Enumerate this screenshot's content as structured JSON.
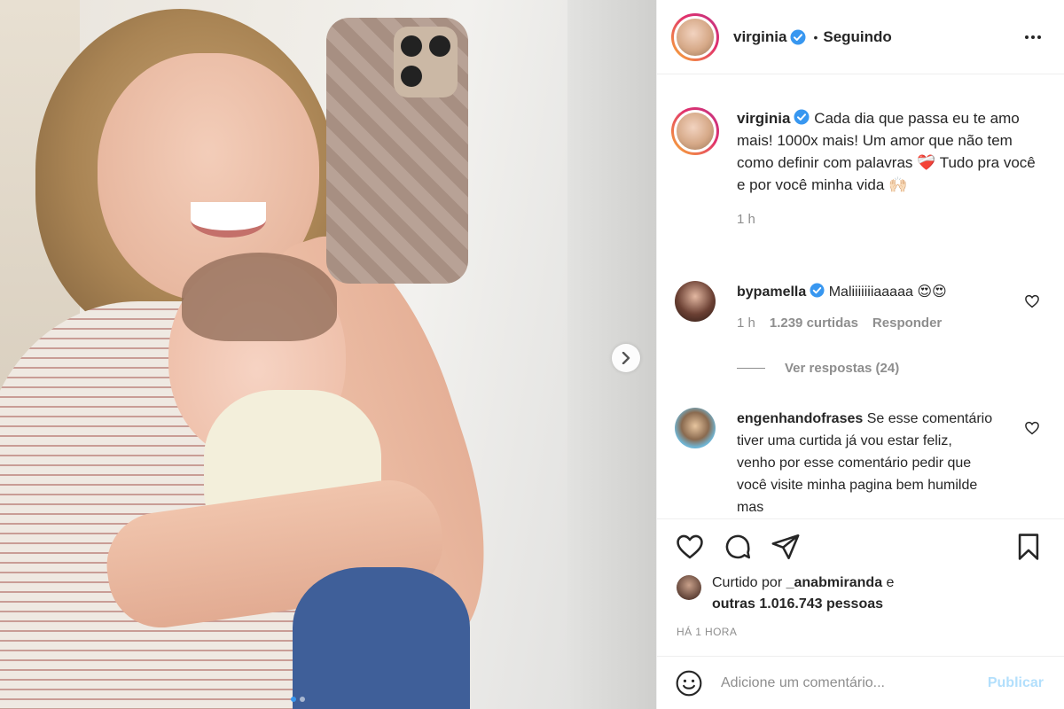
{
  "post": {
    "author": "virginia",
    "follow_status": "Seguindo",
    "separator": "•"
  },
  "caption": {
    "username": "virginia",
    "text": "Cada dia que passa eu te amo mais! 1000x mais! Um amor que não tem como definir com palavras ❤️‍🩹 Tudo pra você e por você minha vida 🙌🏻",
    "time": "1 h"
  },
  "comments": [
    {
      "username": "bypamella",
      "verified": true,
      "text": "Maliiiiiiiaaaaa 😍😍",
      "time": "1 h",
      "likes": "1.239 curtidas",
      "reply_label": "Responder",
      "view_replies": "Ver respostas (24)"
    },
    {
      "username": "engenhandofrases",
      "verified": false,
      "text": "Se esse comentário tiver uma curtida já vou estar feliz, venho por esse comentário pedir que você visite minha pagina bem humilde mas"
    }
  ],
  "likes": {
    "prefix": "Curtido por",
    "liker": "_anabmiranda",
    "connector": "e",
    "others": "outras 1.016.743 pessoas"
  },
  "timestamp": "HÁ 1 HORA",
  "add_comment": {
    "placeholder": "Adicione um comentário...",
    "publish": "Publicar"
  },
  "carousel": {
    "slide_count": 2,
    "active_index": 0
  },
  "colors": {
    "verified_blue": "#3897f0",
    "muted_text": "#8e8e8e",
    "publish_disabled": "#b2dffc",
    "divider": "#efefef"
  },
  "icons": [
    "verified-badge-icon",
    "more-options-icon",
    "chevron-right-icon",
    "heart-icon",
    "comment-icon",
    "share-icon",
    "bookmark-icon",
    "emoji-icon"
  ]
}
